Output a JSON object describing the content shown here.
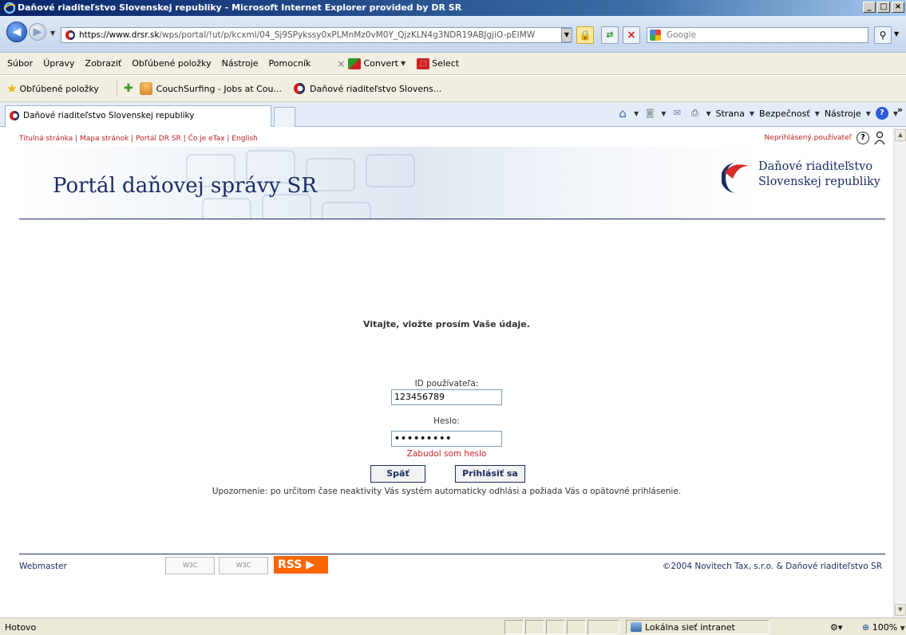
{
  "window": {
    "title": "Daňové riaditeľstvo Slovenskej republiky - Microsoft Internet Explorer provided by DR SR",
    "buttons": {
      "minimize": "_",
      "maximize": "□",
      "close": "×"
    }
  },
  "address": {
    "url_host": "https://www.drsr.sk",
    "url_rest": "/wps/portal/!ut/p/kcxml/04_Sj9SPykssy0xPLMnMz0vM0Y_QjzKLN4g3NDR19ABJgjiO-pEIMW",
    "search_placeholder": "Google"
  },
  "menu": {
    "items": [
      "Súbor",
      "Úpravy",
      "Zobraziť",
      "Obľúbené položky",
      "Nástroje",
      "Pomocník"
    ],
    "convert": "Convert",
    "select": "Select"
  },
  "favorites": {
    "label": "Obľúbené položky",
    "links": [
      "CouchSurfing - Jobs at Cou...",
      "Daňové riaditeľstvo Slovens..."
    ]
  },
  "tabs": {
    "active": "Daňové riaditeľstvo Slovenskej republiky"
  },
  "commandbar": {
    "page": "Strana",
    "safety": "Bezpečnosť",
    "tools": "Nástroje"
  },
  "page": {
    "top_links": [
      "Titulná stránka",
      "Mapa stránok",
      "Portál DR SR",
      "Čo je eTax",
      "English"
    ],
    "user_status": "Neprihlásený používateľ",
    "portal_title": "Portál daňovej správy SR",
    "org_name_line1": "Daňové riaditeľstvo",
    "org_name_line2": "Slovenskej republiky",
    "welcome": "Vitajte, vložte prosím Vaše údaje.",
    "user_id_label": "ID používateľa:",
    "user_id_value": "123456789",
    "password_label": "Heslo:",
    "password_value": "•••••••••",
    "forgot_password": "Zabudol som heslo",
    "back_button": "Späť",
    "login_button": "Prihlásiť sa",
    "warning": "Upozornenie: po určitom čase neaktivity Vás systém automaticky odhlási a požiada Vás o opätovné prihlásenie.",
    "footer_webmaster": "Webmaster",
    "footer_rss": "RSS",
    "footer_copyright": "©2004 Novitech Tax, s.r.o. & Daňové riaditeľstvo SR",
    "w3c_badge": "W3C"
  },
  "status": {
    "text": "Hotovo",
    "zone": "Lokálna sieť intranet",
    "zoom": "100%"
  },
  "colors": {
    "brand_navy": "#1b2e63",
    "link_red": "#b22222",
    "rss_orange": "#ff6600"
  }
}
